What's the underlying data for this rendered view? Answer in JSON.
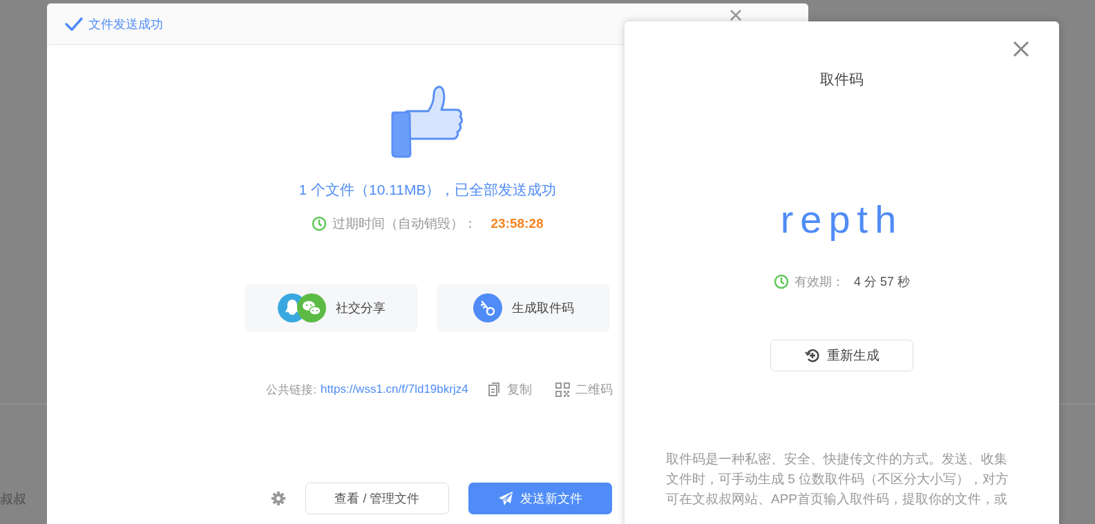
{
  "background": {
    "text": "叔叔"
  },
  "dialog": {
    "title": "文件发送成功",
    "message": "1 个文件（10.11MB），已全部发送成功",
    "expiry_label": "过期时间（自动销毁）：",
    "expiry_time": "23:58:28",
    "actions": [
      {
        "kind": "social",
        "label": "社交分享"
      },
      {
        "kind": "code",
        "label": "生成取件码"
      }
    ],
    "link_label": "公共链接:",
    "link": "https://wss1.cn/f/7ld19bkrjz4",
    "link_actions": [
      {
        "kind": "copy",
        "label": "复制"
      },
      {
        "kind": "qr",
        "label": "二维码"
      }
    ],
    "buttons": [
      {
        "kind": "secondary",
        "label": "查看 / 管理文件"
      },
      {
        "kind": "primary",
        "label": "发送新文件"
      }
    ]
  },
  "code_panel": {
    "title": "取件码",
    "code": "repth",
    "validity_label": "有效期：",
    "validity_value": "4 分 57 秒",
    "regenerate": "重新生成",
    "description": "取件码是一种私密、安全、快捷传文件的方式。发送、收集文件时，可手动生成 5 位数取件码（不区分大小写），对方可在文叔叔网站、APP首页输入取件码，提取你的文件，或"
  }
}
